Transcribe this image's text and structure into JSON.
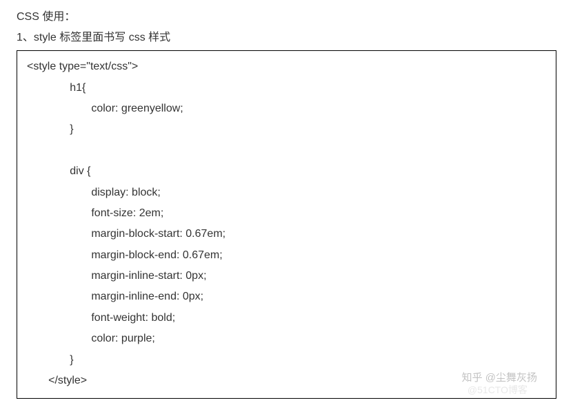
{
  "heading": "CSS 使用：",
  "subheading": "1、style 标签里面书写 css 样式",
  "code": {
    "l1": "<style type=\"text/css\">",
    "l2": "              h1{",
    "l3": "                     color: greenyellow;",
    "l4": "              }",
    "l5": "",
    "l6": "              div {",
    "l7": "                     display: block;",
    "l8": "                     font-size: 2em;",
    "l9": "                     margin-block-start: 0.67em;",
    "l10": "                     margin-block-end: 0.67em;",
    "l11": "                     margin-inline-start: 0px;",
    "l12": "                     margin-inline-end: 0px;",
    "l13": "                     font-weight: bold;",
    "l14": "                     color: purple;",
    "l15": "              }",
    "l16": "       </style>"
  },
  "watermark": "知乎 @尘舞灰扬",
  "watermark2": "@51CTO博客"
}
